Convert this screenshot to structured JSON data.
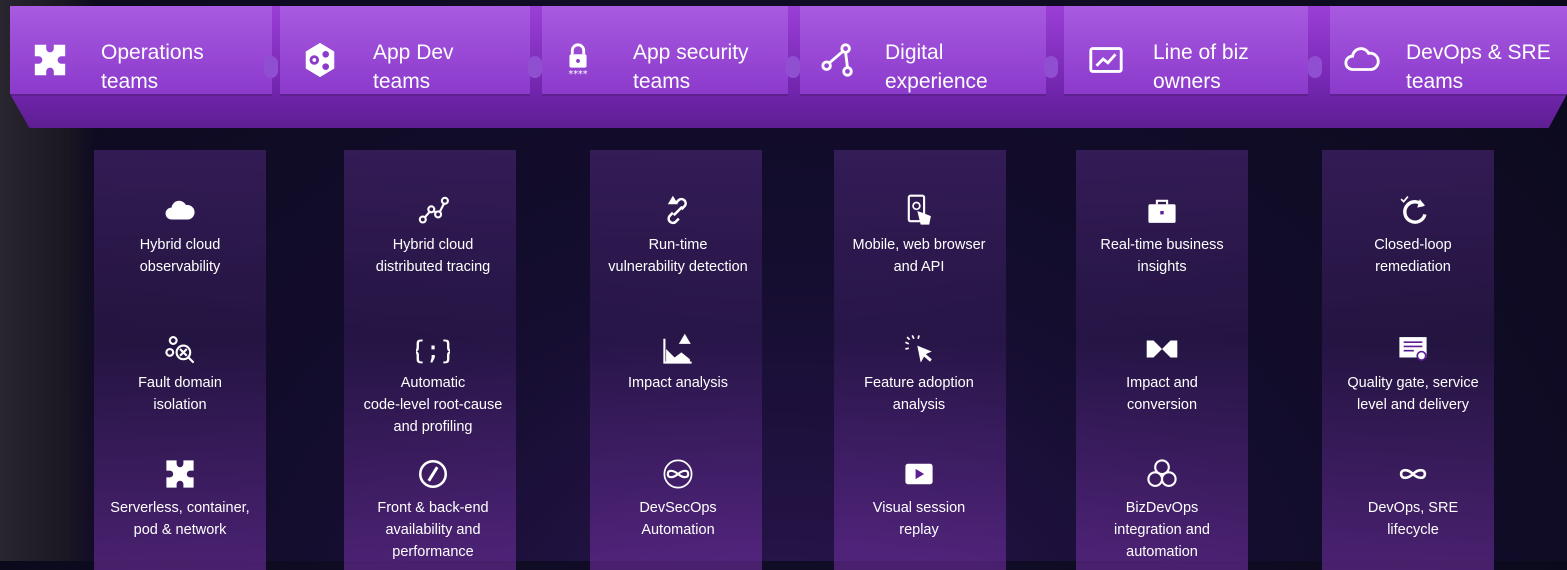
{
  "columns": [
    {
      "title": "Operations\nteams",
      "icon": "puzzle-icon",
      "features": [
        {
          "icon": "cloud-icon",
          "label": "Hybrid cloud\nobservability"
        },
        {
          "icon": "fault-isolation-icon",
          "label": "Fault domain\nisolation"
        },
        {
          "icon": "puzzle-icon",
          "label": "Serverless, container,\npod & network"
        }
      ]
    },
    {
      "title": "App Dev\nteams",
      "icon": "gears-icon",
      "features": [
        {
          "icon": "tracing-icon",
          "label": "Hybrid cloud\ndistributed tracing"
        },
        {
          "icon": "code-braces-icon",
          "label": "Automatic\ncode-level root-cause\nand profiling"
        },
        {
          "icon": "gauge-icon",
          "label": "Front & back-end\navailability and\nperformance"
        }
      ]
    },
    {
      "title": "App security\nteams",
      "icon": "lock-icon",
      "features": [
        {
          "icon": "broken-link-warning-icon",
          "label": "Run-time\nvulnerability detection"
        },
        {
          "icon": "impact-chart-warning-icon",
          "label": "Impact analysis"
        },
        {
          "icon": "devsecops-loop-icon",
          "label": "DevSecOps\nAutomation"
        }
      ]
    },
    {
      "title": "Digital\nexperience",
      "icon": "journey-icon",
      "features": [
        {
          "icon": "mobile-touch-icon",
          "label": "Mobile, web browser\nand API"
        },
        {
          "icon": "click-cursor-icon",
          "label": "Feature adoption\nanalysis"
        },
        {
          "icon": "play-icon",
          "label": "Visual session\nreplay"
        }
      ]
    },
    {
      "title": "Line of biz\nowners",
      "icon": "dashboard-icon",
      "features": [
        {
          "icon": "briefcase-icon",
          "label": "Real-time business\ninsights"
        },
        {
          "icon": "funnel-icon",
          "label": "Impact and\nconversion"
        },
        {
          "icon": "bizdevops-icon",
          "label": "BizDevOps\nintegration and\nautomation"
        }
      ]
    },
    {
      "title": "DevOps & SRE\nteams",
      "icon": "cloud-outline-icon",
      "features": [
        {
          "icon": "closed-loop-icon",
          "label": "Closed-loop\nremediation"
        },
        {
          "icon": "certificate-icon",
          "label": "Quality gate, service\nlevel and delivery"
        },
        {
          "icon": "infinity-icon",
          "label": "DevOps, SRE\nlifecycle"
        }
      ]
    }
  ],
  "colors": {
    "header": "#8b3acb",
    "text": "#ffffff",
    "background": "#0b0a1c"
  }
}
